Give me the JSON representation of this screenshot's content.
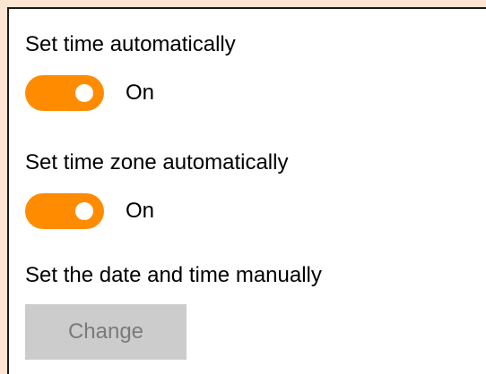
{
  "settings": {
    "set_time_auto": {
      "label": "Set time automatically",
      "state": "On",
      "enabled": true
    },
    "set_timezone_auto": {
      "label": "Set time zone automatically",
      "state": "On",
      "enabled": true
    },
    "manual": {
      "label": "Set the date and time manually",
      "button_label": "Change",
      "button_disabled": true
    }
  },
  "colors": {
    "background": "#fce6d3",
    "panel": "#ffffff",
    "toggle_on": "#ff8c00",
    "button_disabled_bg": "#cccccc",
    "button_disabled_text": "#7a7a7a"
  }
}
